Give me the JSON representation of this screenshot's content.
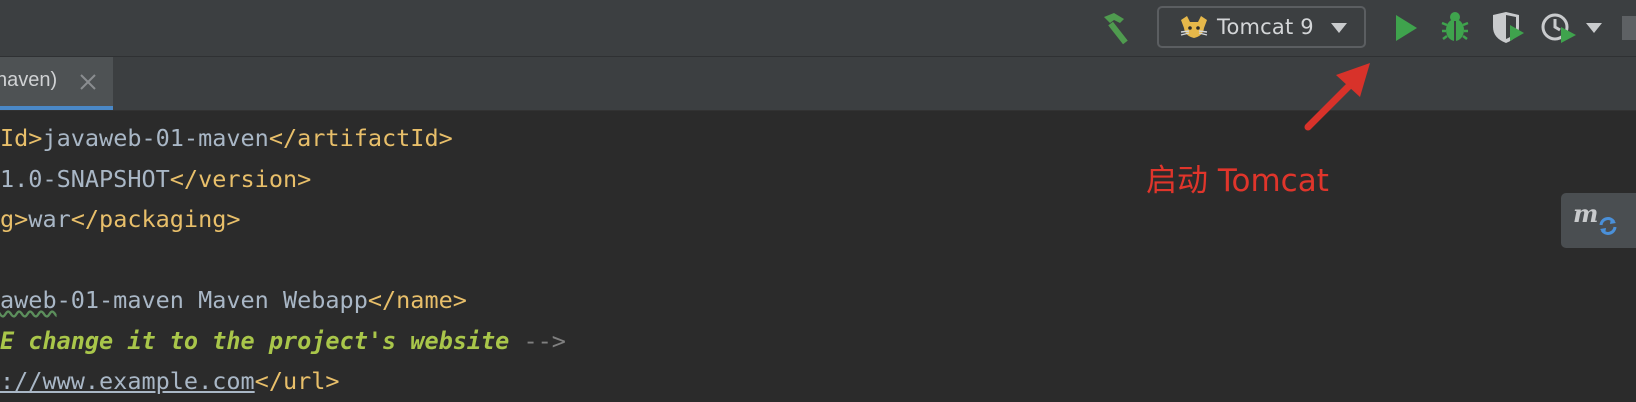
{
  "toolbar": {
    "run_config_label": "Tomcat 9",
    "icons": [
      "hammer-icon",
      "tomcat-cat-icon",
      "chevron-down-icon",
      "run-icon",
      "debug-icon",
      "coverage-icon",
      "profiler-icon",
      "more-dropdown-icon",
      "stop-icon"
    ],
    "colors": {
      "run": "#3fa34d",
      "hammer": "#4f9b4f"
    }
  },
  "tab": {
    "label": "naven)",
    "close_icon": "close-icon"
  },
  "code_lines": [
    {
      "segments": [
        {
          "t": "Id>",
          "c": "tag"
        },
        {
          "t": "javaweb-01-maven",
          "c": "txt"
        },
        {
          "t": "</artifactId>",
          "c": "tag"
        }
      ]
    },
    {
      "segments": [
        {
          "t": "1.0-SNAPSHOT",
          "c": "txt"
        },
        {
          "t": "</version>",
          "c": "tag"
        }
      ]
    },
    {
      "segments": [
        {
          "t": "g>",
          "c": "tag"
        },
        {
          "t": "war",
          "c": "txt"
        },
        {
          "t": "</packaging>",
          "c": "tag"
        }
      ]
    },
    {
      "segments": []
    },
    {
      "segments": [
        {
          "t": "aweb",
          "c": "txt squig"
        },
        {
          "t": "-01-maven Maven Webapp",
          "c": "txt"
        },
        {
          "t": "</name>",
          "c": "tag"
        }
      ]
    },
    {
      "segments": [
        {
          "t": "E change it to the project's website ",
          "c": "cmt"
        },
        {
          "t": "-->",
          "c": "cmt-m"
        }
      ]
    },
    {
      "segments": [
        {
          "t": "://www.example.com",
          "c": "url"
        },
        {
          "t": "</url>",
          "c": "tag"
        }
      ]
    }
  ],
  "annotation": {
    "text": "启动 Tomcat",
    "color": "#e0352b"
  },
  "maven_badge": {
    "letter": "m",
    "icon": "maven-sync-icon"
  }
}
